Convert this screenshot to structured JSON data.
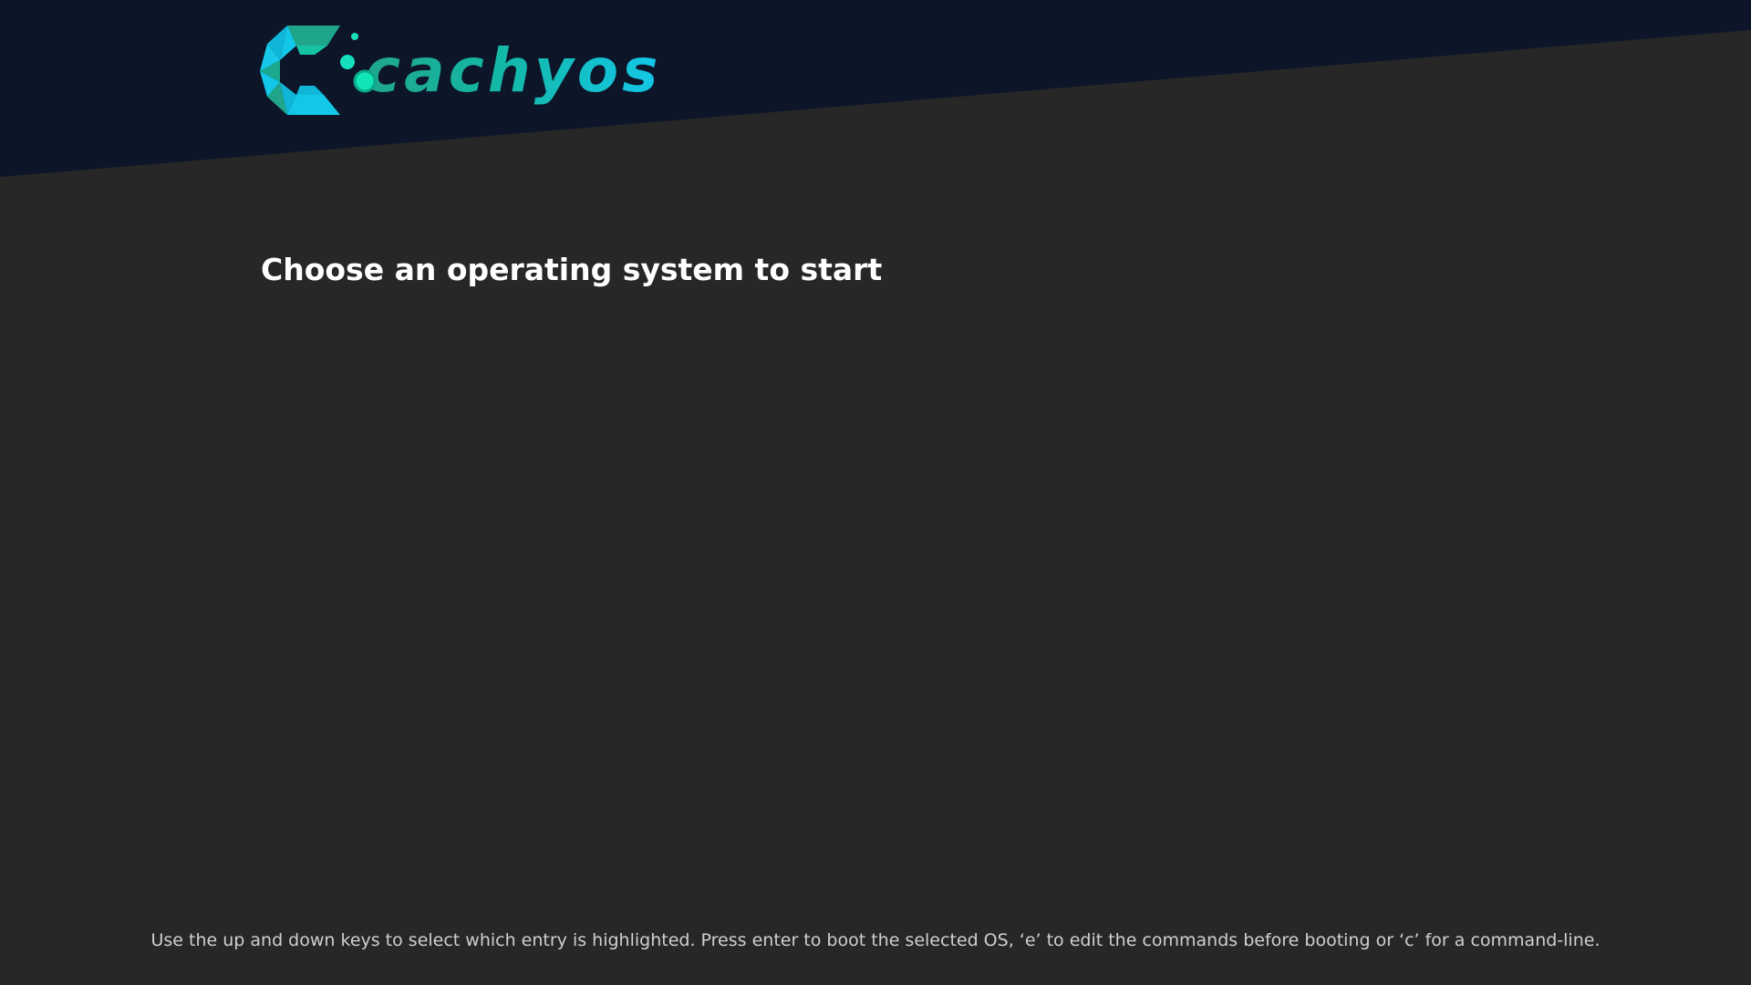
{
  "brand": {
    "name": "cachyos",
    "icon": "cachyos-logo-icon",
    "colors": {
      "teal": "#1fa68a",
      "cyan": "#13c7e8",
      "green": "#18b58f"
    }
  },
  "theme": {
    "header_bg": "#0d1629",
    "body_bg": "#272727",
    "title_color": "#ffffff",
    "help_color": "#cfcfcf"
  },
  "menu": {
    "title": "Choose an operating system to start",
    "entries": []
  },
  "help": {
    "text": "Use the up and down keys to select which entry is highlighted. Press enter to boot the selected OS, ‘e’ to edit the commands before booting or ‘c’ for a command-line."
  }
}
